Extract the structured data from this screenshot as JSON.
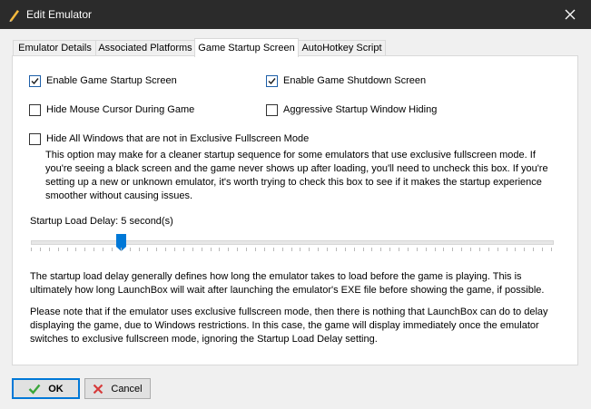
{
  "window": {
    "title": "Edit Emulator",
    "close_icon": "close-icon"
  },
  "tabs": [
    {
      "label": "Emulator Details",
      "active": false
    },
    {
      "label": "Associated Platforms",
      "active": false
    },
    {
      "label": "Game Startup Screen",
      "active": true
    },
    {
      "label": "AutoHotkey Script",
      "active": false
    }
  ],
  "options": {
    "enable_startup": {
      "label": "Enable Game Startup Screen",
      "checked": true
    },
    "enable_shutdown": {
      "label": "Enable Game Shutdown Screen",
      "checked": true
    },
    "hide_cursor": {
      "label": "Hide Mouse Cursor During Game",
      "checked": false
    },
    "aggressive_hiding": {
      "label": "Aggressive Startup Window Hiding",
      "checked": false
    },
    "hide_windows": {
      "label": "Hide All Windows that are not in Exclusive Fullscreen Mode",
      "checked": false
    }
  },
  "hide_windows_description": "This option may make for a cleaner startup sequence for some emulators that use exclusive fullscreen mode. If you're seeing a black screen and the game never shows up after loading, you'll need to uncheck this box. If you're setting up a new or unknown emulator, it's worth trying to check this box to see if it makes the startup experience smoother without causing issues.",
  "delay": {
    "label": "Startup Load Delay: 5 second(s)",
    "value_seconds": 5,
    "accent": "#0078d7"
  },
  "delay_description_1": "The startup load delay generally defines how long the emulator takes to load before the game is playing. This is ultimately how long LaunchBox will wait after launching the emulator's EXE file before showing the game, if possible.",
  "delay_description_2": "Please note that if the emulator uses exclusive fullscreen mode, then there is nothing that LaunchBox can do to delay displaying the game, due to Windows restrictions. In this case, the game will display immediately once the emulator switches to exclusive fullscreen mode, ignoring the Startup Load Delay setting.",
  "buttons": {
    "ok": "OK",
    "cancel": "Cancel"
  }
}
